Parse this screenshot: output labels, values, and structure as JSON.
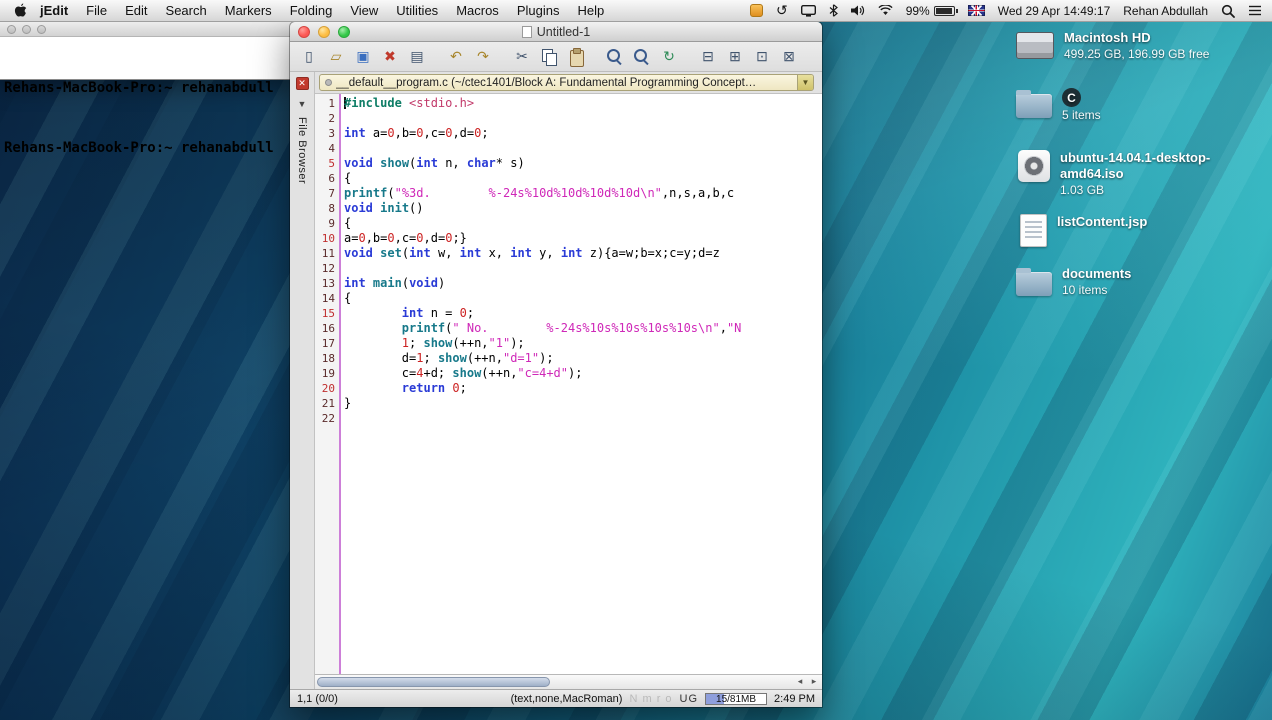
{
  "menu_bar": {
    "items": [
      {
        "name": "menu-jedit",
        "label": "jEdit",
        "cls": "bold"
      },
      {
        "name": "menu-file",
        "label": "File"
      },
      {
        "name": "menu-edit",
        "label": "Edit"
      },
      {
        "name": "menu-search",
        "label": "Search"
      },
      {
        "name": "menu-markers",
        "label": "Markers"
      },
      {
        "name": "menu-folding",
        "label": "Folding"
      },
      {
        "name": "menu-view",
        "label": "View"
      },
      {
        "name": "menu-utilities",
        "label": "Utilities"
      },
      {
        "name": "menu-macros",
        "label": "Macros"
      },
      {
        "name": "menu-plugins",
        "label": "Plugins"
      },
      {
        "name": "menu-help",
        "label": "Help"
      }
    ],
    "status": {
      "battery": "99%",
      "clock": "Wed 29 Apr 14:49:17",
      "user": "Rehan Abdullah"
    }
  },
  "terminal": {
    "lines": [
      "Rehans-MacBook-Pro:~ rehanabdull",
      "Rehans-MacBook-Pro:~ rehanabdull"
    ]
  },
  "jedit": {
    "title": "Untitled-1",
    "toolbar": [
      {
        "name": "new-file-button",
        "glyph": "▯",
        "cls": ""
      },
      {
        "name": "open-file-button",
        "glyph": "▱",
        "cls": "gold"
      },
      {
        "name": "save-file-button",
        "glyph": "▣",
        "cls": "blue"
      },
      {
        "name": "close-buffer-button",
        "glyph": "✖",
        "cls": "red"
      },
      {
        "name": "print-button",
        "glyph": "▤",
        "cls": ""
      },
      {
        "name": "undo-button",
        "glyph": "↶",
        "cls": "gold gap"
      },
      {
        "name": "redo-button",
        "glyph": "↷",
        "cls": "gold"
      },
      {
        "name": "cut-button",
        "glyph": "✂",
        "cls": "gap"
      },
      {
        "name": "copy-button",
        "glyph": "",
        "cls": "copy"
      },
      {
        "name": "paste-button",
        "glyph": "",
        "cls": "paste"
      },
      {
        "name": "find-button",
        "glyph": "",
        "cls": "mag gap"
      },
      {
        "name": "find-next-button",
        "glyph": "",
        "cls": "mag"
      },
      {
        "name": "reload-button",
        "glyph": "↻",
        "cls": "green"
      },
      {
        "name": "split-horizontal-button",
        "glyph": "⊟",
        "cls": "gap"
      },
      {
        "name": "split-vertical-button",
        "glyph": "⊞",
        "cls": ""
      },
      {
        "name": "unsplit-button",
        "glyph": "⊡",
        "cls": ""
      },
      {
        "name": "new-view-button",
        "glyph": "⊠",
        "cls": ""
      }
    ],
    "buffer_switcher": {
      "value": "__default__program.c (~/ctec1401/Block A: Fundamental Programming Concept…",
      "arrow": "▼"
    },
    "dock": {
      "label": "File Browser",
      "close": "✕",
      "arrow": "▼"
    },
    "editor": {
      "lines": [
        [
          [
            "d",
            "#include"
          ],
          [
            "p",
            " "
          ],
          [
            "m",
            "<stdio.h>"
          ]
        ],
        [],
        [
          [
            "k",
            "int"
          ],
          [
            "p",
            " a="
          ],
          [
            "n",
            "0"
          ],
          [
            "p",
            ",b="
          ],
          [
            "n",
            "0"
          ],
          [
            "p",
            ",c="
          ],
          [
            "n",
            "0"
          ],
          [
            "p",
            ",d="
          ],
          [
            "n",
            "0"
          ],
          [
            "p",
            ";"
          ]
        ],
        [],
        [
          [
            "k",
            "void"
          ],
          [
            "p",
            " "
          ],
          [
            "f",
            "show"
          ],
          [
            "p",
            "("
          ],
          [
            "k",
            "int"
          ],
          [
            "p",
            " n, "
          ],
          [
            "k",
            "char"
          ],
          [
            "p",
            "* s)"
          ]
        ],
        [
          [
            "p",
            "{"
          ]
        ],
        [
          [
            "f",
            "printf"
          ],
          [
            "p",
            "("
          ],
          [
            "s",
            "\"%3d.        %-24s%10d%10d%10d%10d\\n\""
          ],
          [
            "p",
            ",n,s,a,b,c"
          ]
        ],
        [
          [
            "k",
            "void"
          ],
          [
            "p",
            " "
          ],
          [
            "f",
            "init"
          ],
          [
            "p",
            "()"
          ]
        ],
        [
          [
            "p",
            "{"
          ]
        ],
        [
          [
            "p",
            "a="
          ],
          [
            "n",
            "0"
          ],
          [
            "p",
            ",b="
          ],
          [
            "n",
            "0"
          ],
          [
            "p",
            ",c="
          ],
          [
            "n",
            "0"
          ],
          [
            "p",
            ",d="
          ],
          [
            "n",
            "0"
          ],
          [
            "p",
            ";}"
          ]
        ],
        [
          [
            "k",
            "void"
          ],
          [
            "p",
            " "
          ],
          [
            "f",
            "set"
          ],
          [
            "p",
            "("
          ],
          [
            "k",
            "int"
          ],
          [
            "p",
            " w, "
          ],
          [
            "k",
            "int"
          ],
          [
            "p",
            " x, "
          ],
          [
            "k",
            "int"
          ],
          [
            "p",
            " y, "
          ],
          [
            "k",
            "int"
          ],
          [
            "p",
            " z){a=w;b=x;c=y;d=z"
          ]
        ],
        [],
        [
          [
            "k",
            "int"
          ],
          [
            "p",
            " "
          ],
          [
            "f",
            "main"
          ],
          [
            "p",
            "("
          ],
          [
            "k",
            "void"
          ],
          [
            "p",
            ")"
          ]
        ],
        [
          [
            "p",
            "{"
          ]
        ],
        [
          [
            "p",
            "        "
          ],
          [
            "k",
            "int"
          ],
          [
            "p",
            " n = "
          ],
          [
            "n",
            "0"
          ],
          [
            "p",
            ";"
          ]
        ],
        [
          [
            "p",
            "        "
          ],
          [
            "f",
            "printf"
          ],
          [
            "p",
            "("
          ],
          [
            "s",
            "\" No.        %-24s%10s%10s%10s%10s\\n\""
          ],
          [
            "p",
            ","
          ],
          [
            "s",
            "\"N"
          ]
        ],
        [
          [
            "p",
            "        "
          ],
          [
            "n",
            "1"
          ],
          [
            "p",
            "; "
          ],
          [
            "f",
            "show"
          ],
          [
            "p",
            "(++n,"
          ],
          [
            "s",
            "\"1\""
          ],
          [
            "p",
            ");"
          ]
        ],
        [
          [
            "p",
            "        "
          ],
          [
            "p",
            "d="
          ],
          [
            "n",
            "1"
          ],
          [
            "p",
            "; "
          ],
          [
            "f",
            "show"
          ],
          [
            "p",
            "(++n,"
          ],
          [
            "s",
            "\"d=1\""
          ],
          [
            "p",
            ");"
          ]
        ],
        [
          [
            "p",
            "        "
          ],
          [
            "p",
            "c="
          ],
          [
            "n",
            "4"
          ],
          [
            "p",
            "+d; "
          ],
          [
            "f",
            "show"
          ],
          [
            "p",
            "(++n,"
          ],
          [
            "s",
            "\"c=4+d\""
          ],
          [
            "p",
            ");"
          ]
        ],
        [
          [
            "p",
            "        "
          ],
          [
            "k",
            "return"
          ],
          [
            "p",
            " "
          ],
          [
            "n",
            "0"
          ],
          [
            "p",
            ";"
          ]
        ],
        [
          [
            "p",
            "}"
          ]
        ],
        []
      ]
    },
    "status_bar": {
      "caret": "1,1 (0/0)",
      "mode": "(text,none,MacRoman)",
      "flags_dim": "N m r o",
      "flags": "UG",
      "memory": "15/81MB",
      "time": "2:49 PM"
    }
  },
  "desktop": {
    "icons": [
      {
        "title": "Macintosh HD",
        "subtitle": "499.25 GB, 196.99 GB free"
      },
      {
        "title": "C",
        "subtitle": "5 items"
      },
      {
        "title": "ubuntu-14.04.1-desktop-amd64.iso",
        "subtitle": "1.03 GB"
      },
      {
        "title": "listContent.jsp",
        "subtitle": ""
      },
      {
        "title": "documents",
        "subtitle": "10 items"
      }
    ]
  },
  "colors": {
    "accent_purple_gutter_border": "#cd7fd8",
    "keyword_blue": "#2a3bd6",
    "string_magenta": "#cf28b8",
    "memory_fill_blue": "#8f9fdc"
  }
}
